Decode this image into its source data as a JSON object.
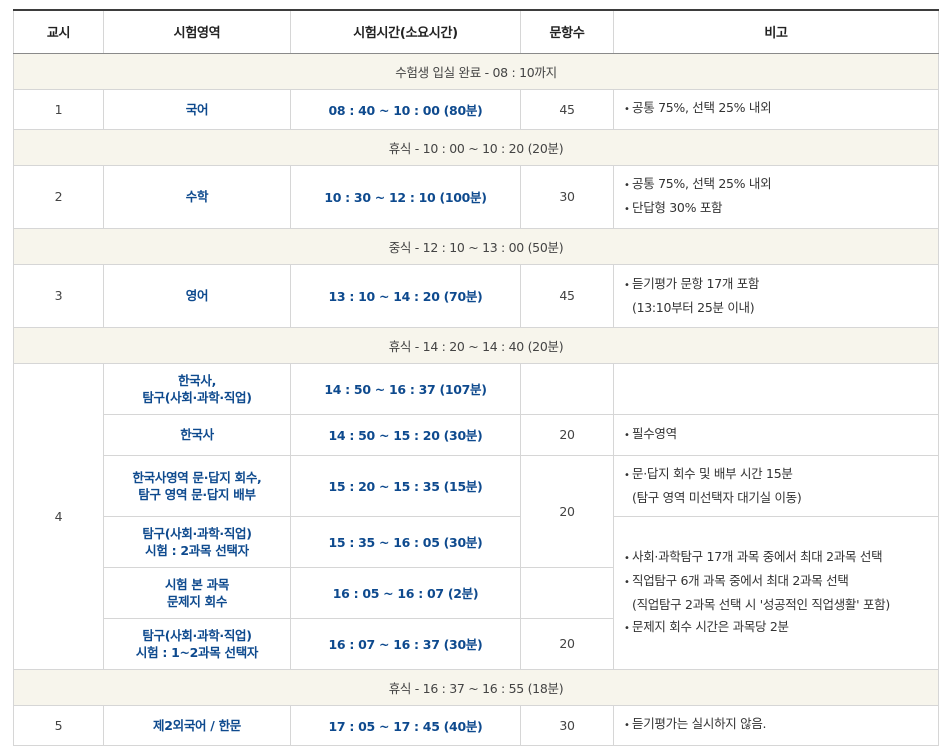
{
  "headers": [
    "교시",
    "시험영역",
    "시험시간(소요시간)",
    "문항수",
    "비고"
  ],
  "notes": {
    "entry": "수험생 입실 완료 - 08 : 10까지",
    "break1": "휴식 - 10 : 00 ~ 10 : 20 (20분)",
    "lunch": "중식 - 12 : 10 ~ 13 : 00 (50분)",
    "break2": "휴식 - 14 : 20 ~ 14 : 40 (20분)",
    "break3": "휴식 - 16 : 37 ~ 16 : 55 (18분)"
  },
  "p1": {
    "period": "1",
    "subject": "국어",
    "time": "08 : 40 ~ 10 : 00 (80분)",
    "count": "45",
    "remarks": [
      "공통 75%, 선택 25% 내외"
    ]
  },
  "p2": {
    "period": "2",
    "subject": "수학",
    "time": "10 : 30 ~ 12 : 10 (100분)",
    "count": "30",
    "remarks": [
      "공통 75%, 선택 25% 내외",
      "단답형 30% 포함"
    ]
  },
  "p3": {
    "period": "3",
    "subject": "영어",
    "time": "13 : 10 ~ 14 : 20 (70분)",
    "count": "45",
    "remarks": [
      "듣기평가 문항 17개 포함",
      "(13:10부터 25분 이내)"
    ]
  },
  "p4": {
    "period": "4",
    "rows": [
      {
        "subject": [
          "한국사,",
          "탐구(사회·과학·직업)"
        ],
        "time": "14 : 50 ~ 16 : 37 (107분)",
        "count": ""
      },
      {
        "subject": [
          "한국사"
        ],
        "time": "14 : 50 ~ 15 : 20 (30분)",
        "count": "20",
        "remarks": [
          "필수영역"
        ]
      },
      {
        "subject": [
          "한국사영역 문·답지 회수,",
          "탐구 영역 문·답지 배부"
        ],
        "time": "15 : 20 ~ 15 : 35 (15분)",
        "remarks": [
          "문·답지 회수 및 배부 시간 15분",
          "(탐구 영역 미선택자 대기실 이동)"
        ]
      },
      {
        "subject": [
          "탐구(사회·과학·직업)",
          "시험 : 2과목 선택자"
        ],
        "time": "15 : 35 ~ 16 : 05 (30분)",
        "count": "20"
      },
      {
        "subject": [
          "시험 본 과목",
          "문제지 회수"
        ],
        "time": "16 : 05 ~ 16 : 07 (2분)"
      },
      {
        "subject": [
          "탐구(사회·과학·직업)",
          "시험 : 1~2과목 선택자"
        ],
        "time": "16 : 07 ~ 16 : 37 (30분)",
        "count": "20"
      }
    ],
    "inquiry_remarks": [
      "사회·과학탐구 17개 과목 중에서 최대 2과목 선택",
      "직업탐구 6개 과목 중에서 최대 2과목 선택",
      "(직업탐구 2과목 선택 시 '성공적인 직업생활' 포함)",
      "문제지 회수 시간은 과목당 2분"
    ]
  },
  "p5": {
    "period": "5",
    "subject": "제2외국어 / 한문",
    "time": "17 : 05 ~ 17 : 45 (40분)",
    "count": "30",
    "remarks": [
      "듣기평가는 실시하지 않음."
    ]
  }
}
